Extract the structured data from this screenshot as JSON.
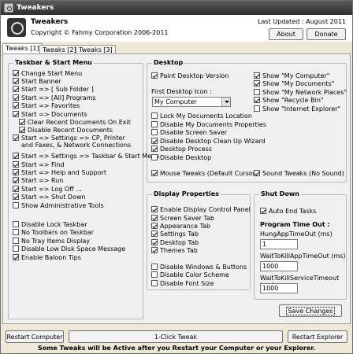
{
  "window": {
    "title": "Tweakers"
  },
  "header": {
    "app_name": "Tweakers",
    "copyright": "Copyright © Fahmy Corporation 2006-2011",
    "last_updated": "Last Updated : August 2011",
    "about_label": "About",
    "donate_label": "Donate"
  },
  "tabs": [
    "Tweaks [1]",
    "Tweaks [2]",
    "Tweaks [3]"
  ],
  "taskbar": {
    "title": "Taskbar & Start Menu",
    "items": [
      {
        "label": "Change Start Menu",
        "checked": true
      },
      {
        "label": "Start Banner",
        "checked": true
      },
      {
        "label": "Start => [ Sub Folder ]",
        "checked": true
      },
      {
        "label": "Start => [All] Programs",
        "checked": true
      },
      {
        "label": "Start => Favorites",
        "checked": true
      },
      {
        "label": "Start => Documents",
        "checked": true
      },
      {
        "label": "Clear Recent Documents On Exit",
        "checked": true
      },
      {
        "label": "Disable Recent Documents",
        "checked": true
      },
      {
        "label": "Start => Settings => CP, Printer and Faxes, & Network Connections",
        "checked": true
      },
      {
        "label": "Start => Settings => Taskbar & Start Menu",
        "checked": true
      },
      {
        "label": "Start => Find",
        "checked": true
      },
      {
        "label": "Start => Help and Support",
        "checked": true
      },
      {
        "label": "Start => Run",
        "checked": true
      },
      {
        "label": "Start => Log Off ...",
        "checked": true
      },
      {
        "label": "Start => Shut Down",
        "checked": true
      },
      {
        "label": "Show Administrative Tools",
        "checked": false
      },
      {
        "label": "Disable Lock Taskbar",
        "checked": false
      },
      {
        "label": "No Toolbars on Taskbar",
        "checked": false
      },
      {
        "label": "No Tray Items Display",
        "checked": false
      },
      {
        "label": "Disable Low Disk Space Message",
        "checked": false
      },
      {
        "label": "Enable Baloon Tips",
        "checked": true
      }
    ]
  },
  "desktop": {
    "title": "Desktop",
    "paint_version": {
      "label": "Paint Desktop Version",
      "checked": true
    },
    "first_icon_label": "First Desktop Icon :",
    "first_icon_value": "My Computer",
    "left_items": [
      {
        "label": "Lock My Documents Location",
        "checked": false
      },
      {
        "label": "Disable My Documents Properties",
        "checked": false
      },
      {
        "label": "Disable Screen Saver",
        "checked": false
      },
      {
        "label": "Disable Desktop Clean Up Wizard",
        "checked": true
      },
      {
        "label": "Desktop Process",
        "checked": true
      },
      {
        "label": "Disable Desktop",
        "checked": false
      }
    ],
    "right_items": [
      {
        "label": "Show \"My Computer\"",
        "checked": true
      },
      {
        "label": "Show \"My Documents\"",
        "checked": true
      },
      {
        "label": "Show \"My Network Places\"",
        "checked": false
      },
      {
        "label": "Show \"Recycle Bin\"",
        "checked": true
      },
      {
        "label": "Show \"Internet Explorer\"",
        "checked": false
      }
    ],
    "mouse_tweaks": {
      "label": "Mouse Tweaks (Default Cursor)",
      "checked": true
    },
    "sound_tweaks": {
      "label": "Sound Tweaks (No Sound)",
      "checked": true
    }
  },
  "display": {
    "title": "Display Properties",
    "items": [
      {
        "label": "Enable Display Control Panel",
        "checked": true
      },
      {
        "label": "Screen Saver Tab",
        "checked": true
      },
      {
        "label": "Appearance Tab",
        "checked": true
      },
      {
        "label": "Settings Tab",
        "checked": true
      },
      {
        "label": "Desktop Tab",
        "checked": true
      },
      {
        "label": "Themes Tab",
        "checked": true
      },
      {
        "label": "Disable Windows & Buttons",
        "checked": false
      },
      {
        "label": "Disable Color Scheme",
        "checked": false
      },
      {
        "label": "Disable Font Size",
        "checked": false
      }
    ]
  },
  "shutdown": {
    "title": "Shut Down",
    "auto_end": {
      "label": "Auto End Tasks",
      "checked": true
    },
    "timeout_title": "Program Time Out :",
    "hung_label": "HungAppTimeOut (ms)",
    "hung_value": "1",
    "wait_app_label": "WaitToKillAppTimeOut (ms)",
    "wait_app_value": "1000",
    "wait_svc_label": "WaitToKillServiceTimeout (ms)",
    "wait_svc_value": "1000"
  },
  "buttons": {
    "save": "Save Changes",
    "restart_computer": "Restart Computer",
    "one_click": "1-Click Tweak",
    "restart_explorer": "Restart Explorer"
  },
  "footer_note": "Some Tweaks will be Active after you Restart your Computer or your Explorer."
}
